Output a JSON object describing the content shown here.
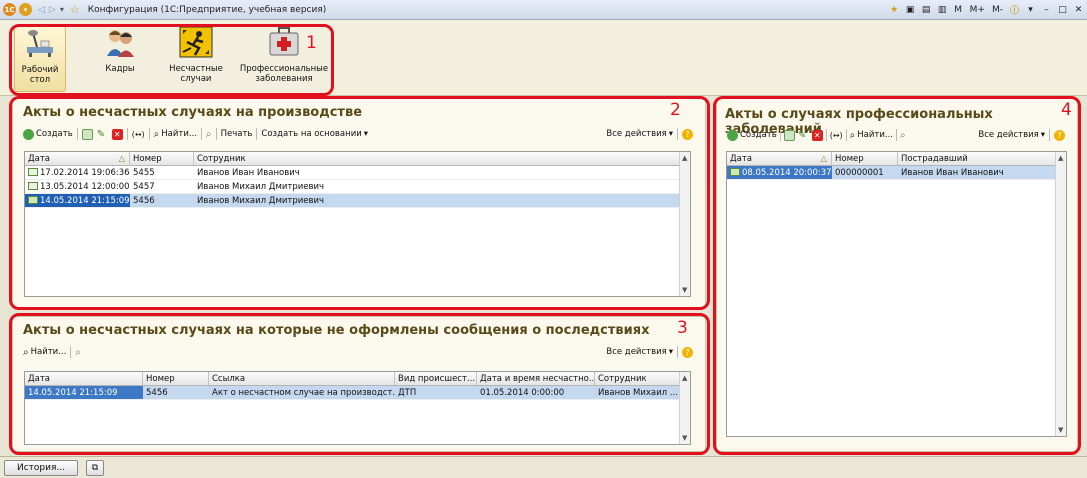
{
  "window": {
    "title": "Конфигурация (1С:Предприятие, учебная версия)",
    "buttons": [
      "M",
      "M+",
      "M-"
    ]
  },
  "sections": [
    {
      "label_1": "Рабочий",
      "label_2": "стол",
      "icon": "desktop-icon"
    },
    {
      "label_1": "Кадры",
      "label_2": "",
      "icon": "staff-icon"
    },
    {
      "label_1": "Несчастные",
      "label_2": "случаи",
      "icon": "accident-icon"
    },
    {
      "label_1": "Профессиональные",
      "label_2": "заболевания",
      "icon": "medkit-icon"
    }
  ],
  "annotations": [
    "1",
    "2",
    "3",
    "4"
  ],
  "panel_accidents": {
    "title": "Акты о несчастных случаях на производстве",
    "toolbar": {
      "create": "Создать",
      "find": "Найти...",
      "print": "Печать",
      "create_based": "Создать на основании",
      "all_actions": "Все действия"
    },
    "columns": [
      "Дата",
      "Номер",
      "Сотрудник"
    ],
    "rows": [
      {
        "date": "17.02.2014 19:06:36",
        "number": "5455",
        "employee": "Иванов Иван Иванович"
      },
      {
        "date": "13.05.2014 12:00:00",
        "number": "5457",
        "employee": "Иванов Михаил Дмитриевич"
      },
      {
        "date": "14.05.2014 21:15:09",
        "number": "5456",
        "employee": "Иванов Михаил Дмитриевич"
      }
    ]
  },
  "panel_unreported": {
    "title": "Акты о несчастных случаях на которые не оформлены сообщения о последствиях",
    "toolbar": {
      "find": "Найти...",
      "all_actions": "Все действия"
    },
    "columns": [
      "Дата",
      "Номер",
      "Ссылка",
      "Вид происшест...",
      "Дата и время несчастно...",
      "Сотрудник"
    ],
    "rows": [
      {
        "date": "14.05.2014 21:15:09",
        "number": "5456",
        "link": "Акт о несчастном случае на производст...",
        "kind": "ДТП",
        "datetime": "01.05.2014 0:00:00",
        "employee": "Иванов Михаил ..."
      }
    ]
  },
  "panel_occupational": {
    "title": "Акты о случаях профессиональных заболеваний",
    "toolbar": {
      "create": "Создать",
      "find": "Найти...",
      "all_actions": "Все действия"
    },
    "columns": [
      "Дата",
      "Номер",
      "Пострадавший"
    ],
    "rows": [
      {
        "date": "08.05.2014 20:00:37",
        "number": "000000001",
        "victim": "Иванов Иван Иванович"
      }
    ]
  },
  "statusbar": {
    "history": "История..."
  }
}
